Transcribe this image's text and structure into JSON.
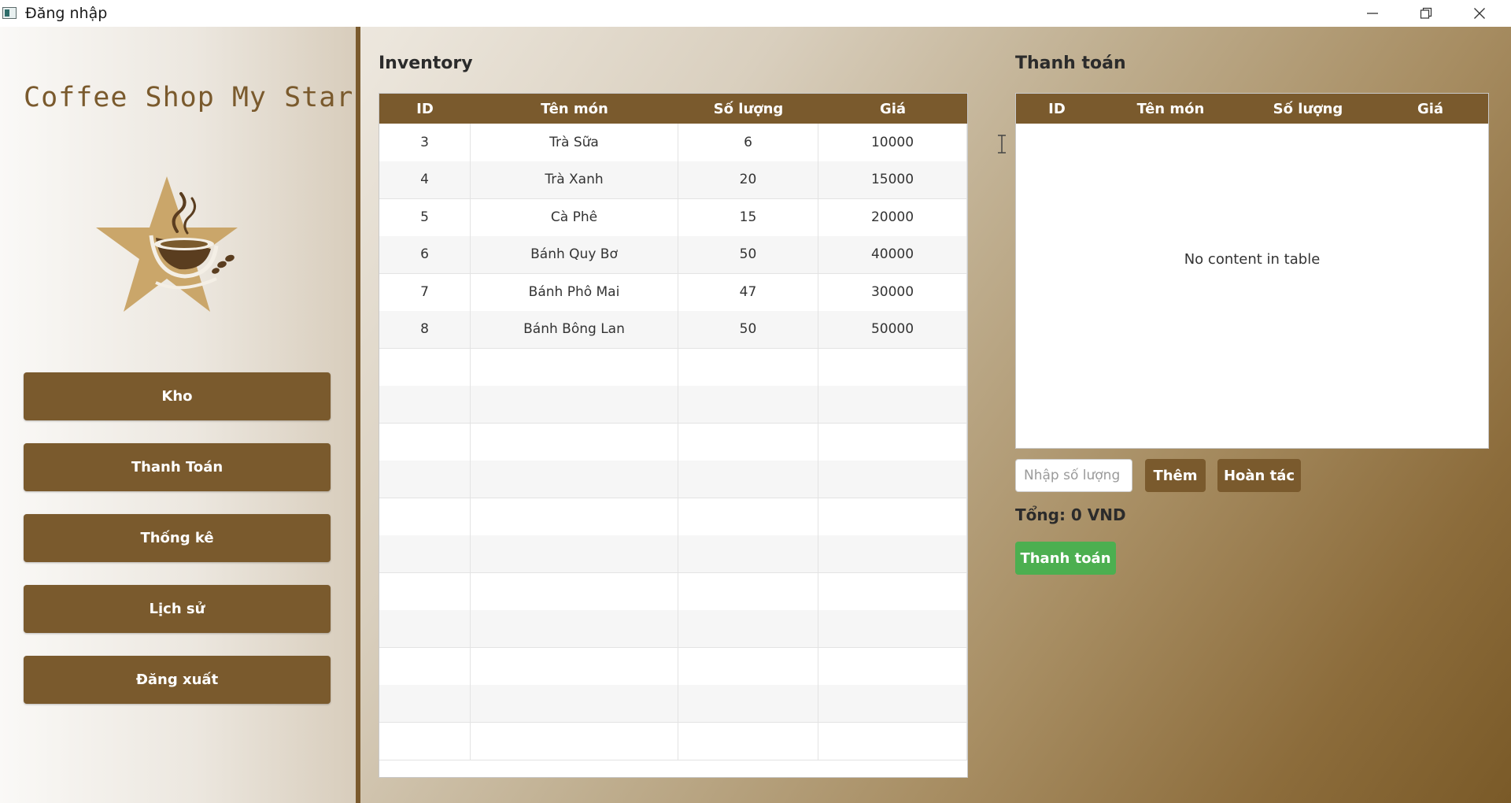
{
  "window": {
    "title": "Đăng nhập"
  },
  "sidebar": {
    "brand": "Coffee Shop My Star",
    "logo_icon": "star-coffee-cup-icon",
    "buttons": [
      {
        "label": "Kho"
      },
      {
        "label": "Thanh Toán"
      },
      {
        "label": "Thống kê"
      },
      {
        "label": "Lịch sử"
      },
      {
        "label": "Đăng xuất"
      }
    ]
  },
  "inventory": {
    "title": "Inventory",
    "columns": [
      "ID",
      "Tên món",
      "Số lượng",
      "Giá"
    ],
    "rows": [
      [
        "3",
        "Trà Sữa",
        "6",
        "10000"
      ],
      [
        "4",
        "Trà Xanh",
        "20",
        "15000"
      ],
      [
        "5",
        "Cà Phê",
        "15",
        "20000"
      ],
      [
        "6",
        "Bánh Quy Bơ",
        "50",
        "40000"
      ],
      [
        "7",
        "Bánh Phô Mai",
        "47",
        "30000"
      ],
      [
        "8",
        "Bánh Bông Lan",
        "50",
        "50000"
      ]
    ]
  },
  "payment": {
    "title": "Thanh toán",
    "columns": [
      "ID",
      "Tên món",
      "Số lượng",
      "Giá"
    ],
    "empty_text": "No content in table",
    "quantity_placeholder": "Nhập số lượng",
    "add_label": "Thêm",
    "undo_label": "Hoàn tác",
    "total_text": "Tổng: 0 VND",
    "pay_label": "Thanh toán"
  },
  "colors": {
    "accent_brown": "#7a5a2d",
    "pay_green": "#4caf50"
  }
}
